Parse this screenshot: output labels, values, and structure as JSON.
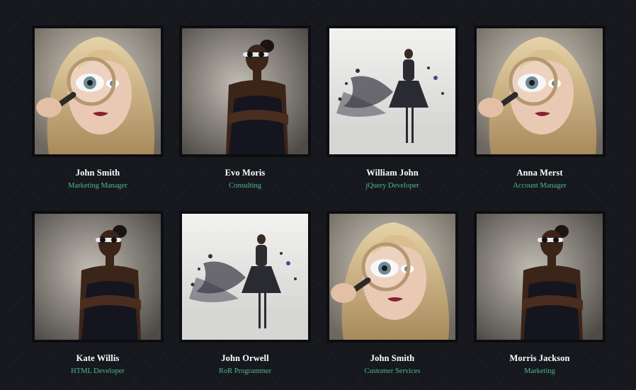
{
  "accent_color": "#4fb88f",
  "members": [
    {
      "name": "John Smith",
      "role": "Marketing Manager",
      "photo": "magnifier"
    },
    {
      "name": "Evo Moris",
      "role": "Consulting",
      "photo": "sunglasses"
    },
    {
      "name": "William John",
      "role": "jQuery Developer",
      "photo": "splash"
    },
    {
      "name": "Anna Merst",
      "role": "Account Manager",
      "photo": "magnifier"
    },
    {
      "name": "Kate Willis",
      "role": "HTML Developer",
      "photo": "sunglasses"
    },
    {
      "name": "John Orwell",
      "role": "RoR Programmer",
      "photo": "splash"
    },
    {
      "name": "John Smith",
      "role": "Customer Services",
      "photo": "magnifier"
    },
    {
      "name": "Morris Jackson",
      "role": "Marketing",
      "photo": "sunglasses"
    }
  ]
}
